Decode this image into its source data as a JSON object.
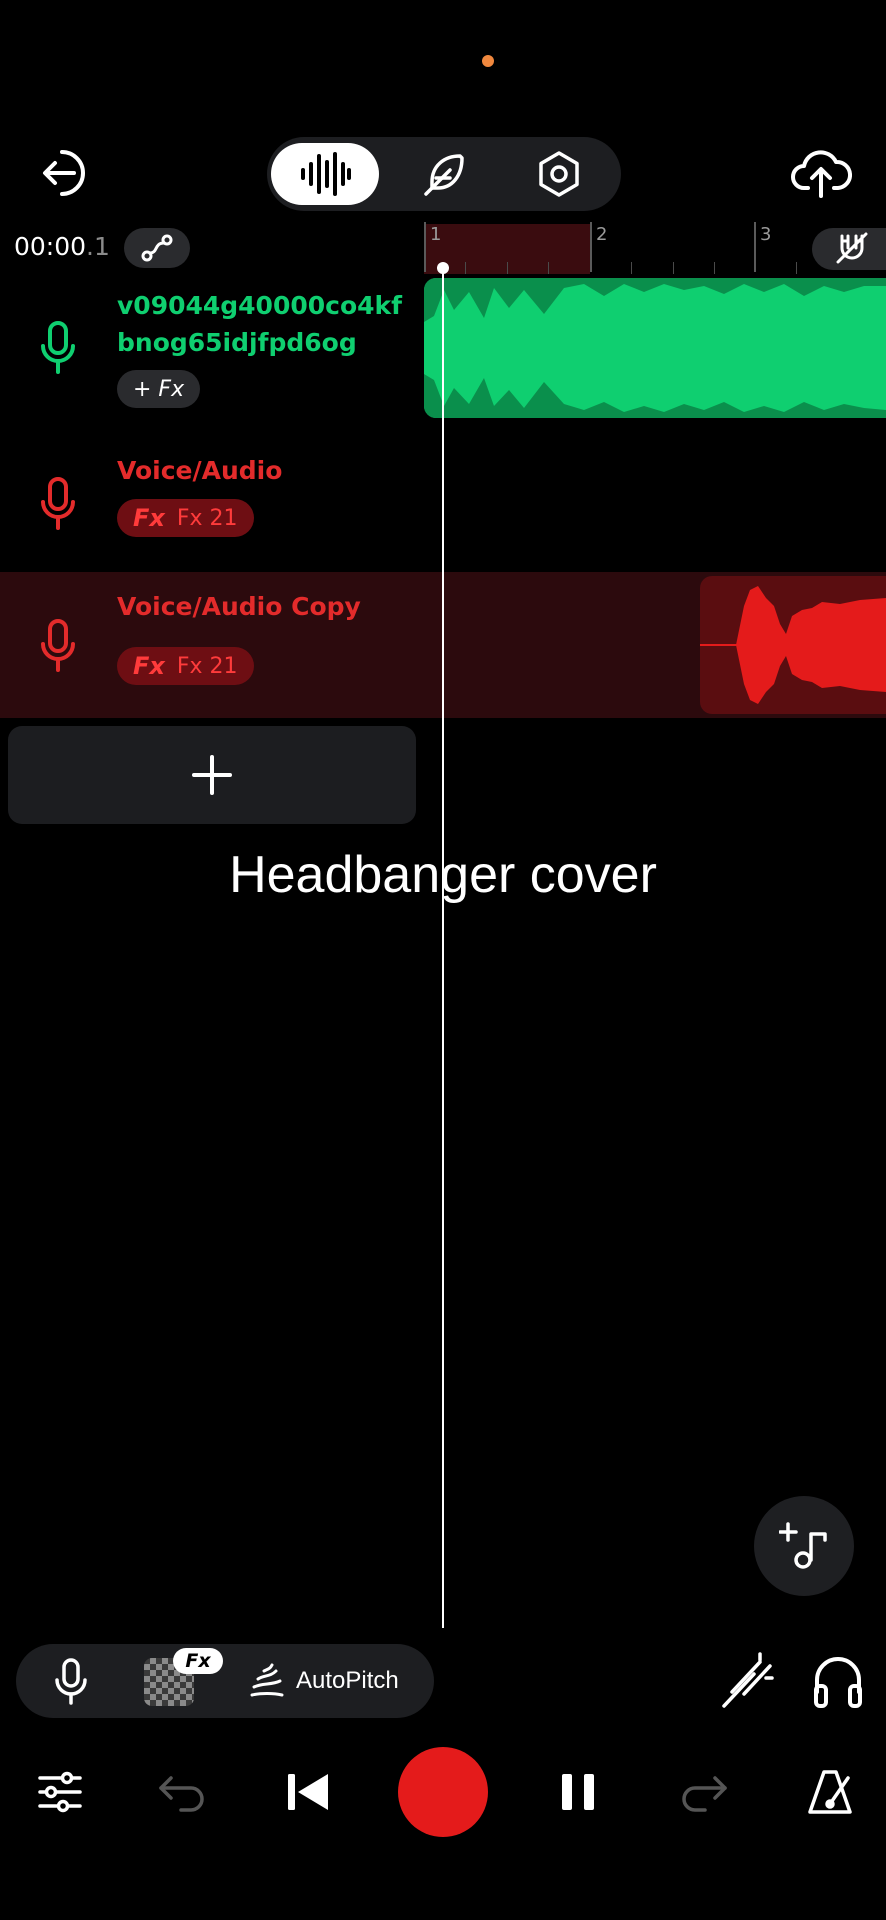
{
  "colors": {
    "accent_green": "#0fcf70",
    "accent_red": "#e41b1b",
    "track_red_text": "#e32b2b",
    "selected_row_bg": "#2c0a0d",
    "status_dot": "#f0883e"
  },
  "header": {
    "mode_tabs": [
      {
        "icon": "waveform-icon",
        "active": true
      },
      {
        "icon": "feather-icon",
        "active": false
      },
      {
        "icon": "settings-hexagon-icon",
        "active": false
      }
    ],
    "back_icon": "exit-arrow-icon",
    "upload_icon": "cloud-upload-icon"
  },
  "timeline": {
    "time_main": "00:00",
    "time_sub": ".1",
    "ruler_marks": [
      "1",
      "2",
      "3"
    ],
    "playhead_position": 0.02
  },
  "tracks": [
    {
      "name_line1": "v09044g40000co4kf",
      "name_line2": "bnog65idjfpd6og",
      "fx_label": "+ Fx",
      "color": "#0fcf70",
      "selected": false
    },
    {
      "name": "Voice/Audio",
      "fx_mark": "Fx",
      "fx_label": "Fx 21",
      "color": "#e32b2b",
      "selected": false
    },
    {
      "name": "Voice/Audio Copy",
      "fx_mark": "Fx",
      "fx_label": "Fx 21",
      "color": "#e32b2b",
      "selected": true
    }
  ],
  "project": {
    "title": "Headbanger cover"
  },
  "toolbar": {
    "fx_badge": "Fx",
    "autopitch_label": "AutoPitch"
  }
}
